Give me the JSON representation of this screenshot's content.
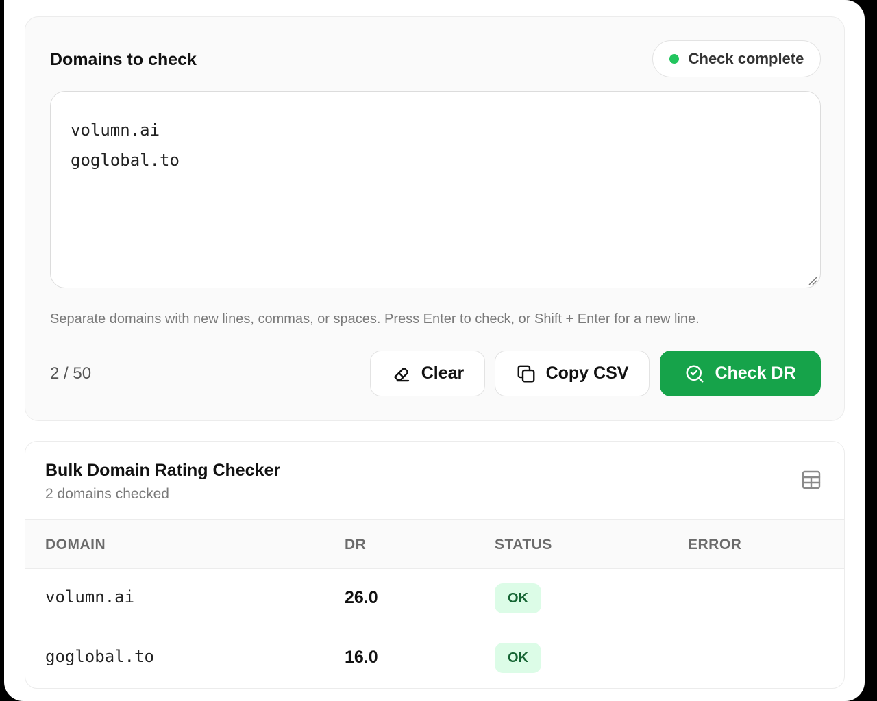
{
  "input_card": {
    "title": "Domains to check",
    "status_label": "Check complete",
    "domains_text": "volumn.ai\ngoglobal.to",
    "hint": "Separate domains with new lines, commas, or spaces. Press Enter to check, or Shift + Enter for a new line.",
    "count": "2 / 50",
    "buttons": {
      "clear": "Clear",
      "copy_csv": "Copy CSV",
      "check": "Check DR"
    }
  },
  "results": {
    "title": "Bulk Domain Rating Checker",
    "subtitle": "2 domains checked",
    "columns": [
      "DOMAIN",
      "DR",
      "STATUS",
      "ERROR"
    ],
    "rows": [
      {
        "domain": "volumn.ai",
        "dr": "26.0",
        "status": "OK",
        "error": ""
      },
      {
        "domain": "goglobal.to",
        "dr": "16.0",
        "status": "OK",
        "error": ""
      }
    ]
  },
  "colors": {
    "accent": "#16a34a",
    "status_dot": "#22c55e",
    "ok_badge_bg": "#dcfce7",
    "ok_badge_text": "#166534"
  },
  "icons": {
    "clear": "eraser-icon",
    "copy": "copy-icon",
    "check": "search-check-icon",
    "table": "table-icon"
  }
}
